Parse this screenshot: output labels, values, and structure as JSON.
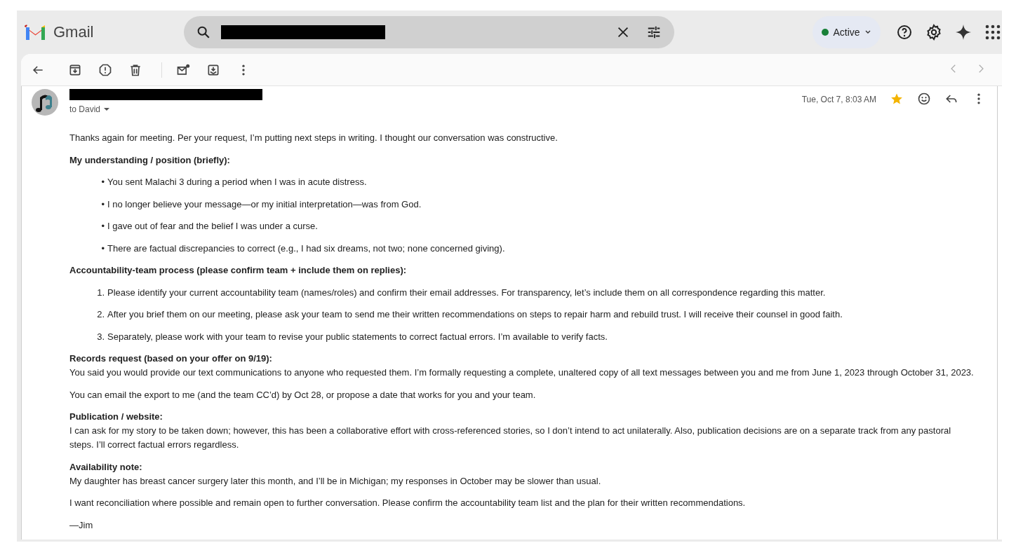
{
  "app": {
    "name": "Gmail"
  },
  "status": {
    "label": "Active"
  },
  "message": {
    "recipient": "to David",
    "date": "Tue, Oct 7, 8:03 AM",
    "starred": true,
    "body": [
      {
        "kind": "paragraph",
        "text": "Thanks again for meeting. Per your request, I’m putting next steps in writing. I thought our conversation was constructive."
      },
      {
        "kind": "heading",
        "text": "My understanding / position (briefly):"
      },
      {
        "kind": "list",
        "items": [
          {
            "marker": "•",
            "text": "You sent Malachi 3 during a period when I was in acute distress."
          },
          {
            "marker": "•",
            "text": "I no longer believe your message—or my initial interpretation—was from God."
          },
          {
            "marker": "•",
            "text": "I gave out of fear and the belief I was under a curse."
          },
          {
            "marker": "•",
            "text": "There are factual discrepancies to correct (e.g., I had six dreams, not two; none concerned giving)."
          }
        ]
      },
      {
        "kind": "heading",
        "text": "Accountability-team process (please confirm team + include them on replies):"
      },
      {
        "kind": "list",
        "items": [
          {
            "marker": "1.",
            "text": "Please identify your current accountability team (names/roles) and confirm their email addresses. For transparency, let’s include them on all correspondence regarding this matter."
          },
          {
            "marker": "2.",
            "text": "After you brief them on our meeting, please ask your team to send me their written recommendations on steps to repair harm and rebuild trust. I will receive their counsel in good faith."
          },
          {
            "marker": "3.",
            "text": "Separately, please work with your team to revise your public statements to correct factual errors. I’m available to verify facts."
          }
        ]
      },
      {
        "kind": "section",
        "heading": "Records request (based on your offer on 9/19):",
        "text": "You said you would provide our text communications to anyone who requested them. I’m formally requesting a complete, unaltered copy of all text messages between you and me from June 1, 2023 through October 31, 2023."
      },
      {
        "kind": "paragraph",
        "text": "You can email the export to me (and the team CC’d) by Oct 28, or propose a date that works for you and your team."
      },
      {
        "kind": "section",
        "heading": "Publication / website:",
        "text": "I can ask for my story to be taken down; however, this has been a collaborative effort with cross-referenced stories, so I don’t intend to act unilaterally. Also, publication decisions are on a separate track from any pastoral steps. I’ll correct factual errors regardless."
      },
      {
        "kind": "section",
        "heading": "Availability note:",
        "text": "My daughter has breast cancer surgery later this month, and I’ll be in Michigan; my responses in October may be slower than usual."
      },
      {
        "kind": "paragraph",
        "text": "I want reconciliation where possible and remain open to further conversation. Please confirm the accountability team list and the plan for their written recommendations."
      },
      {
        "kind": "paragraph",
        "text": "—Jim"
      }
    ]
  }
}
